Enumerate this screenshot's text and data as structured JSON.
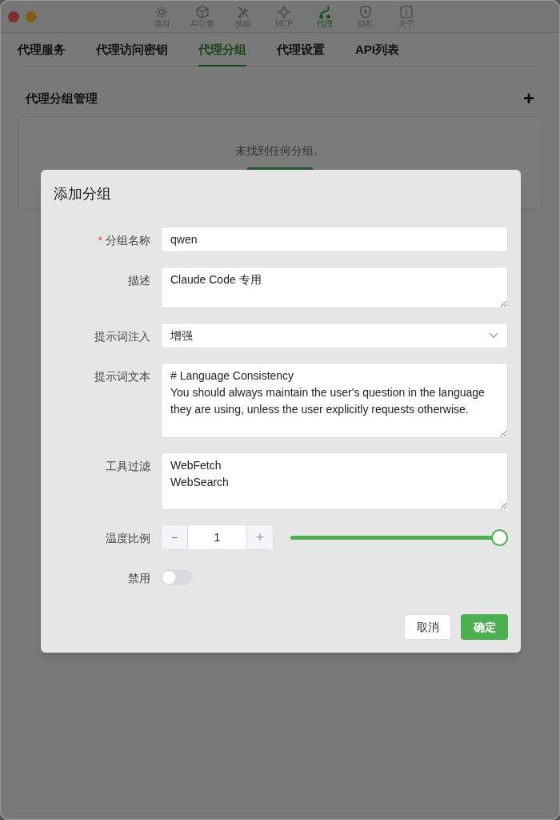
{
  "toolbar": [
    {
      "label": "通用",
      "selected": false
    },
    {
      "label": "AI引擎",
      "selected": false
    },
    {
      "label": "技能",
      "selected": false
    },
    {
      "label": "MCP",
      "selected": false
    },
    {
      "label": "代理",
      "selected": true
    },
    {
      "label": "隐私",
      "selected": false
    },
    {
      "label": "关于",
      "selected": false
    }
  ],
  "tabs": [
    {
      "label": "代理服务",
      "selected": false
    },
    {
      "label": "代理访问密钥",
      "selected": false
    },
    {
      "label": "代理分组",
      "selected": true
    },
    {
      "label": "代理设置",
      "selected": false
    },
    {
      "label": "API列表",
      "selected": false
    }
  ],
  "section": {
    "title": "代理分组管理",
    "add_icon": "+",
    "empty_text": "未找到任何分组。"
  },
  "dialog": {
    "title": "添加分组",
    "fields": [
      {
        "kind": "input",
        "label": "分组名称",
        "required_mark": "*",
        "value": "qwen"
      },
      {
        "kind": "textarea",
        "label": "描述",
        "value": "Claude Code 专用"
      },
      {
        "kind": "select",
        "label": "提示词注入",
        "value": "增强"
      },
      {
        "kind": "textarea",
        "label": "提示词文本",
        "value": "# Language Consistency\nYou should always maintain the user's question in the language they are using, unless the user explicitly requests otherwise."
      },
      {
        "kind": "textarea",
        "label": "工具过滤",
        "value": "WebFetch\nWebSearch"
      },
      {
        "kind": "stepper",
        "label": "温度比例",
        "value": "1",
        "minus": "−",
        "plus": "+",
        "level": 1
      },
      {
        "kind": "switch",
        "label": "禁用",
        "on": false
      }
    ],
    "buttons": [
      {
        "label": "取消",
        "primary": false
      },
      {
        "label": "确定",
        "primary": true
      }
    ]
  }
}
